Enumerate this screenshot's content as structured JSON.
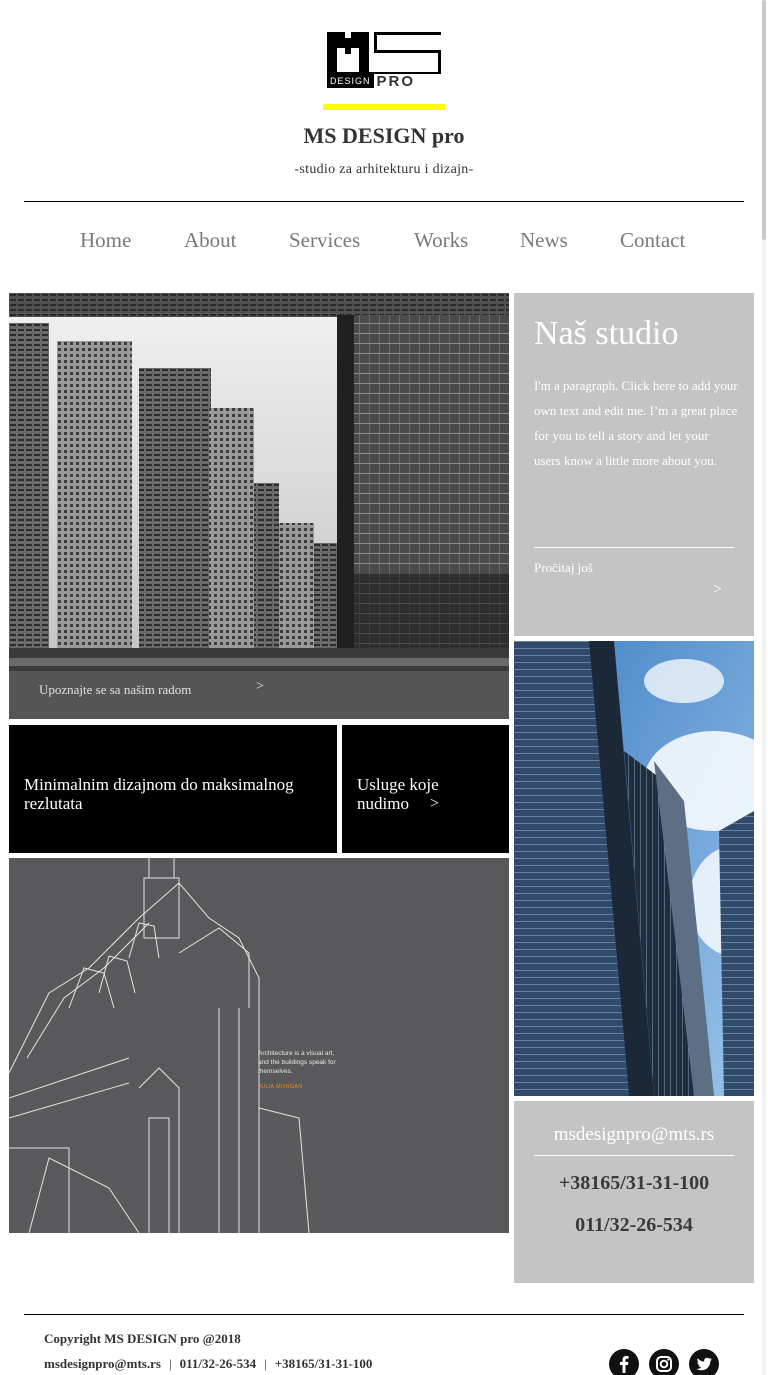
{
  "header": {
    "logo": {
      "ms": "MS",
      "design": "DESIGN",
      "pro": "PRO"
    },
    "title": "MS DESIGN pro",
    "tagline": "-studio za arhitekturu i dizajn-"
  },
  "nav": {
    "items": [
      {
        "label": "Home"
      },
      {
        "label": "About"
      },
      {
        "label": "Services"
      },
      {
        "label": "Works"
      },
      {
        "label": "News"
      },
      {
        "label": "Contact"
      }
    ],
    "color": "#7a7a7a"
  },
  "hero": {
    "caption": "Upoznajte se sa našim radom",
    "arrow": ">"
  },
  "studio": {
    "title": "Naš studio",
    "paragraph": "I'm a paragraph. Click here to add your own text and edit me. I’m a great place for you to tell a story and let your users know a little more about you.",
    "read_more": "Pročitaj još",
    "arrow": ">"
  },
  "tiles": {
    "tile1": "Minimalnim dizajnom do maksimalnog rezlutata",
    "tile2": "Usluge koje nudimo",
    "tile2_arrow": ">"
  },
  "drawing": {
    "quote": "Architecture is a visual art, and the buildings speak for themselves.",
    "author": "JULIA MORGAN"
  },
  "contact": {
    "email": "msdesignpro@mts.rs",
    "phone1": "+38165/31-31-100",
    "phone2": "011/32-26-534"
  },
  "footer": {
    "copyright": "Copyright MS DESIGN pro @2018",
    "email": "msdesignpro@mts.rs",
    "sep": "|",
    "phone1": "011/32-26-534",
    "phone2": "+38165/31-31-100"
  },
  "social": [
    {
      "icon": "facebook-icon"
    },
    {
      "icon": "instagram-icon"
    },
    {
      "icon": "twitter-icon"
    }
  ],
  "colors": {
    "accent_yellow": "#ffff00",
    "card_gray": "#c4c4c4",
    "panel_gray": "#59595b",
    "quote_orange": "#f08a24"
  }
}
